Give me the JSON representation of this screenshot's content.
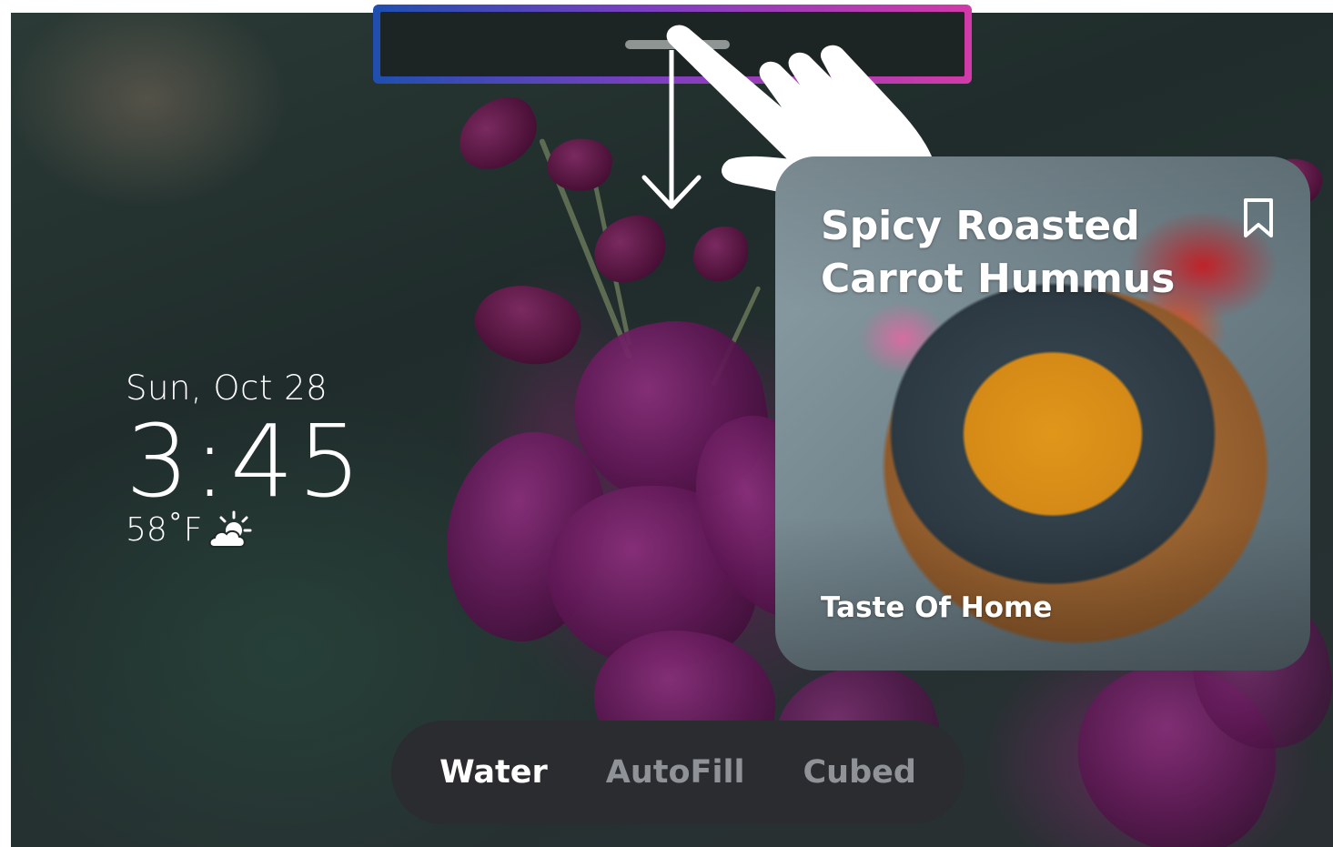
{
  "lock_screen": {
    "date": "Sun, Oct 28",
    "time": "3:45",
    "temperature": "58˚F",
    "weather_icon": "partly-sunny-icon"
  },
  "recipe_card": {
    "title": "Spicy Roasted Carrot Hummus",
    "source": "Taste Of Home",
    "bookmark_icon": "bookmark-icon"
  },
  "mode_bar": {
    "items": [
      {
        "label": "Water",
        "active": true
      },
      {
        "label": "AutoFill",
        "active": false
      },
      {
        "label": "Cubed",
        "active": false
      }
    ]
  },
  "gesture_hint": {
    "icons": [
      "hand-pointer-icon",
      "arrow-down-icon"
    ],
    "highlight_gradient": [
      "#1f4fb0",
      "#7a3fc0",
      "#d23aa8"
    ]
  }
}
